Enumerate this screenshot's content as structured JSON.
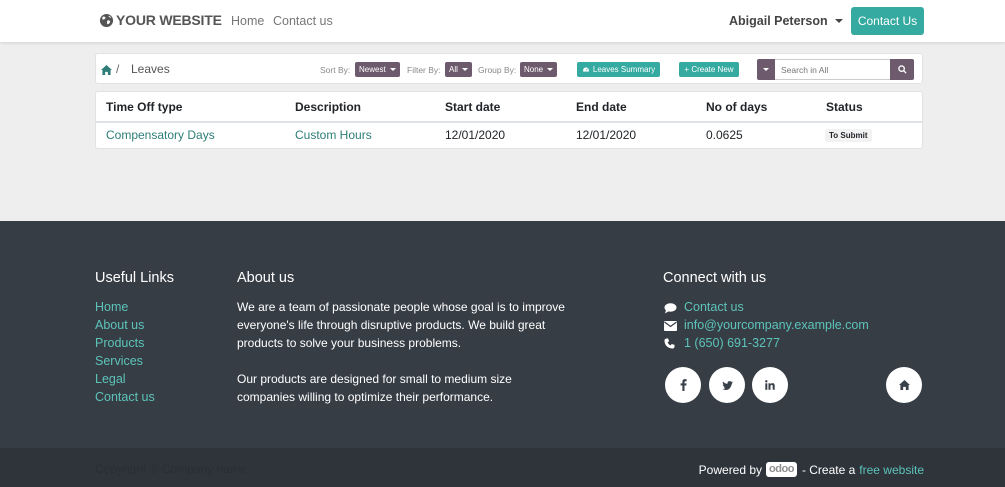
{
  "navbar": {
    "brand": "YOUR WEBSITE",
    "links": [
      "Home",
      "Contact us"
    ],
    "user": "Abigail Peterson",
    "contact_button": "Contact Us"
  },
  "breadcrumb": {
    "home_icon": "home-icon",
    "separator": "/",
    "current": "Leaves"
  },
  "toolbar": {
    "sort_label": "Sort By:",
    "sort_value": "Newest",
    "filter_label": "Filter By:",
    "filter_value": "All",
    "group_label": "Group By:",
    "group_value": "None",
    "summary_button": "Leaves Summary",
    "create_button": "+ Create New",
    "search_placeholder": "Search in All"
  },
  "table": {
    "headers": [
      "Time Off type",
      "Description",
      "Start date",
      "End date",
      "No of days",
      "Status"
    ],
    "rows": [
      {
        "type": "Compensatory Days",
        "description": "Custom Hours",
        "start": "12/01/2020",
        "end": "12/01/2020",
        "days": "0.0625",
        "status": "To Submit"
      }
    ]
  },
  "footer": {
    "useful_links_title": "Useful Links",
    "useful_links": [
      "Home",
      "About us",
      "Products",
      "Services",
      "Legal",
      "Contact us"
    ],
    "about_title": "About us",
    "about_p1_lines": [
      "We are a team of passionate people whose goal is to improve",
      "everyone's life through disruptive products. We build great",
      "products to solve your business problems."
    ],
    "about_p2_lines": [
      "Our products are designed for small to medium size",
      "companies willing to optimize their performance."
    ],
    "connect_title": "Connect with us",
    "contact_link": "Contact us",
    "email": "info@yourcompany.example.com",
    "phone": "1 (650) 691-3277",
    "social_icons": [
      "facebook-icon",
      "twitter-icon",
      "linkedin-icon",
      "home-icon"
    ],
    "copyright": "Copyright © Company name",
    "powered_by": "Powered by",
    "odoo": "odoo",
    "create_a": "- Create a",
    "free_website": "free website"
  },
  "colors": {
    "accent": "#35aaa0",
    "link": "#2e7d78",
    "footer_bg": "#373d45",
    "footer_link": "#5cc4ba",
    "dropdown": "#6d5b6d"
  }
}
